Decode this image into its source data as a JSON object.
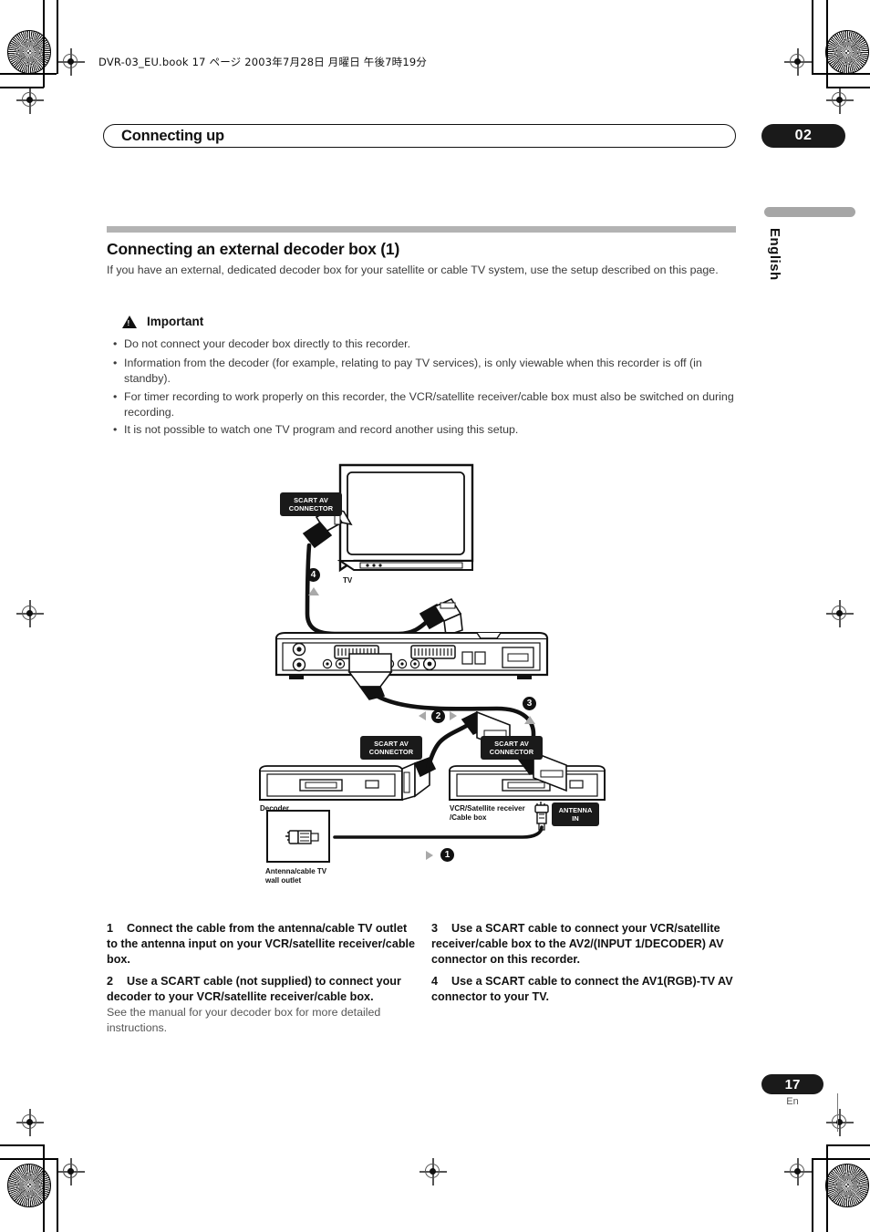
{
  "print_header": {
    "file_line": "DVR-03_EU.book 17 ページ 2003年7月28日  月曜日  午後7時19分"
  },
  "running_head": {
    "title": "Connecting up",
    "chapter": "02"
  },
  "side_rail": {
    "language": "English"
  },
  "section": {
    "title": "Connecting an external decoder box (1)",
    "intro": "If you have an external, dedicated decoder box for your satellite or cable TV system, use the setup described on this page."
  },
  "important": {
    "label": "Important",
    "icon": "warning-triangle-icon",
    "bullets": [
      "Do not connect your decoder box directly to this recorder.",
      "Information from the decoder (for example, relating to pay TV services), is only viewable when this recorder is off (in standby).",
      "For timer recording to work properly on this recorder, the VCR/satellite receiver/cable box must also be switched on during recording.",
      "It is not possible to watch one TV program and record another using this setup."
    ]
  },
  "diagram": {
    "tags": {
      "scart_tv": "SCART AV\nCONNECTOR",
      "scart_decoder": "SCART AV\nCONNECTOR",
      "scart_vcr": "SCART AV\nCONNECTOR",
      "antenna_in": "ANTENNA\nIN"
    },
    "labels": {
      "tv": "TV",
      "decoder": "Decoder",
      "vcr": "VCR/Satellite receiver\n/Cable box",
      "wall_outlet": "Antenna/cable TV\nwall outlet"
    },
    "callouts": [
      {
        "num": "1",
        "arrows": [
          "right"
        ]
      },
      {
        "num": "2",
        "arrows": [
          "left",
          "right"
        ]
      },
      {
        "num": "3",
        "arrows": [
          "up"
        ]
      },
      {
        "num": "4",
        "arrows": [
          "up"
        ]
      }
    ]
  },
  "steps": {
    "left": [
      {
        "num": "1",
        "text": "Connect the cable from the antenna/cable TV outlet to the antenna input on your VCR/satellite receiver/cable box.",
        "note": ""
      },
      {
        "num": "2",
        "text": "Use a SCART cable (not supplied) to connect your decoder to your VCR/satellite receiver/cable box.",
        "note": "See the manual for your decoder box for more detailed instructions."
      }
    ],
    "right": [
      {
        "num": "3",
        "text": "Use a SCART cable to connect your VCR/satellite receiver/cable box to the AV2/(INPUT 1/DECODER) AV connector on this recorder.",
        "note": ""
      },
      {
        "num": "4",
        "text": "Use a SCART cable to connect the AV1(RGB)-TV AV connector to your TV.",
        "note": ""
      }
    ]
  },
  "footer": {
    "page_number": "17",
    "language_code": "En"
  },
  "colors": {
    "ink": "#111111",
    "body": "#3a3a3a",
    "rule_gray": "#b3b3b3",
    "rail_gray": "#a6a6a6",
    "callout_gray": "#a9a9a9"
  }
}
